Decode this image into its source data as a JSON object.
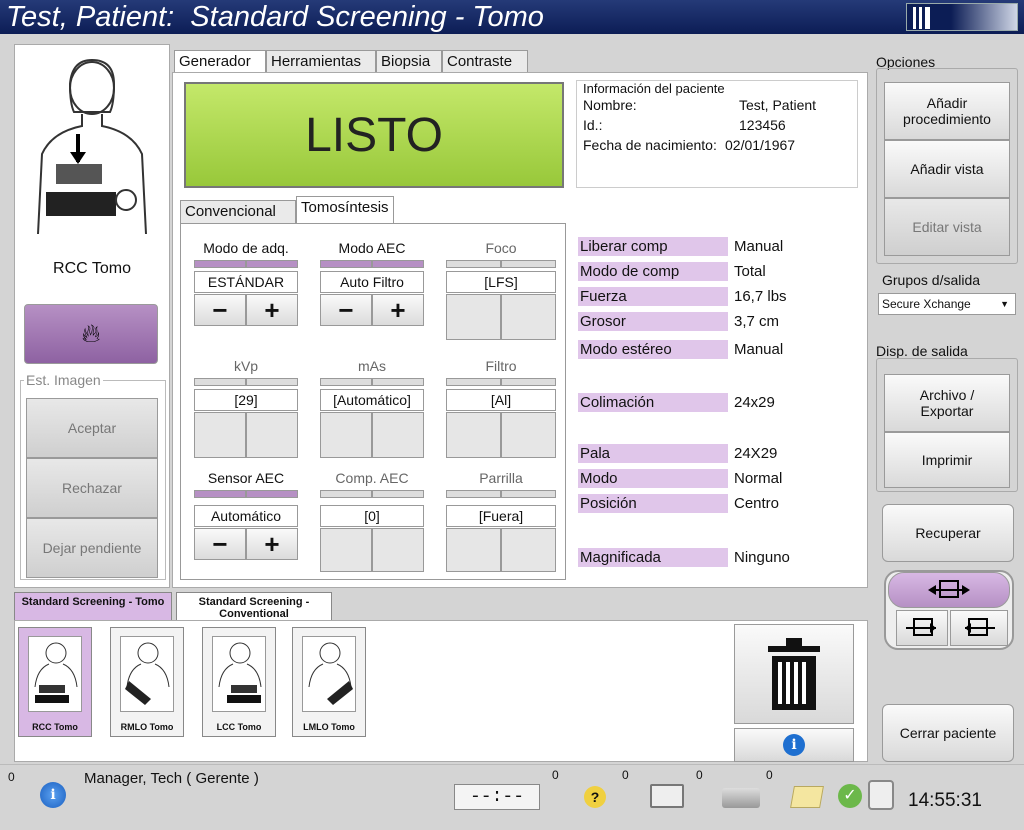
{
  "title": "Test, Patient:  Standard Screening - Tomo",
  "left": {
    "view_label": "RCC Tomo",
    "image_group": "Est. Imagen",
    "accept": "Aceptar",
    "reject": "Rechazar",
    "pending": "Dejar pendiente"
  },
  "tabs": [
    "Generador",
    "Herramientas",
    "Biopsia",
    "Contraste"
  ],
  "status": "LISTO",
  "patient": {
    "header": "Información del paciente",
    "name_label": "Nombre:",
    "name": "Test, Patient",
    "id_label": "Id.:",
    "id": "123456",
    "dob_label": "Fecha de nacimiento:",
    "dob": "02/01/1967"
  },
  "subtabs": [
    "Convencional",
    "Tomosíntesis"
  ],
  "controls": {
    "acq_mode": {
      "label": "Modo de adq.",
      "value": "ESTÁNDAR"
    },
    "aec_mode": {
      "label": "Modo AEC",
      "value": "Auto Filtro"
    },
    "focus": {
      "label": "Foco",
      "value": "[LFS]"
    },
    "kvp": {
      "label": "kVp",
      "value": "[29]"
    },
    "mas": {
      "label": "mAs",
      "value": "[Automático]"
    },
    "filter": {
      "label": "Filtro",
      "value": "[Al]"
    },
    "aec_sensor": {
      "label": "Sensor AEC",
      "value": "Automático"
    },
    "aec_comp": {
      "label": "Comp. AEC",
      "value": "[0]"
    },
    "grid": {
      "label": "Parrilla",
      "value": "[Fuera]"
    },
    "minus": "−",
    "plus": "+"
  },
  "params": [
    {
      "label": "Liberar comp",
      "value": "Manual"
    },
    {
      "label": "Modo de comp",
      "value": "Total"
    },
    {
      "label": "Fuerza",
      "value": "16,7 lbs"
    },
    {
      "label": "Grosor",
      "value": "3,7 cm"
    },
    {
      "label": "Modo estéreo",
      "value": "Manual"
    },
    {
      "label": "Colimación",
      "value": "24x29"
    },
    {
      "label": "Pala",
      "value": "24X29"
    },
    {
      "label": "Modo",
      "value": "Normal"
    },
    {
      "label": "Posición",
      "value": "Centro"
    },
    {
      "label": "Magnificada",
      "value": "Ninguno"
    }
  ],
  "procedures": [
    {
      "label": "Standard Screening - Tomo"
    },
    {
      "label": "Standard Screening - Conventional"
    }
  ],
  "thumbs": [
    "RCC Tomo",
    "RMLO Tomo",
    "LCC Tomo",
    "LMLO Tomo"
  ],
  "right": {
    "options": "Opciones",
    "add_proc": "Añadir procedimiento",
    "add_view": "Añadir vista",
    "edit_view": "Editar vista",
    "output_groups": "Grupos d/salida",
    "output_select": "Secure Xchange",
    "output_devices": "Disp. de salida",
    "archive": "Archivo / Exportar",
    "print": "Imprimir",
    "retrieve": "Recuperar",
    "close": "Cerrar paciente"
  },
  "statusbar": {
    "c0": "0",
    "user": "Manager, Tech ( Gerente )",
    "timer": "--:--",
    "c1": "0",
    "c2": "0",
    "c3": "0",
    "c4": "0",
    "c5": "0",
    "time": "14:55:31"
  },
  "colors": {
    "title_bg": "#0c1d55",
    "status_green": "#a8d84a",
    "accent_purple": "#b690c4"
  }
}
